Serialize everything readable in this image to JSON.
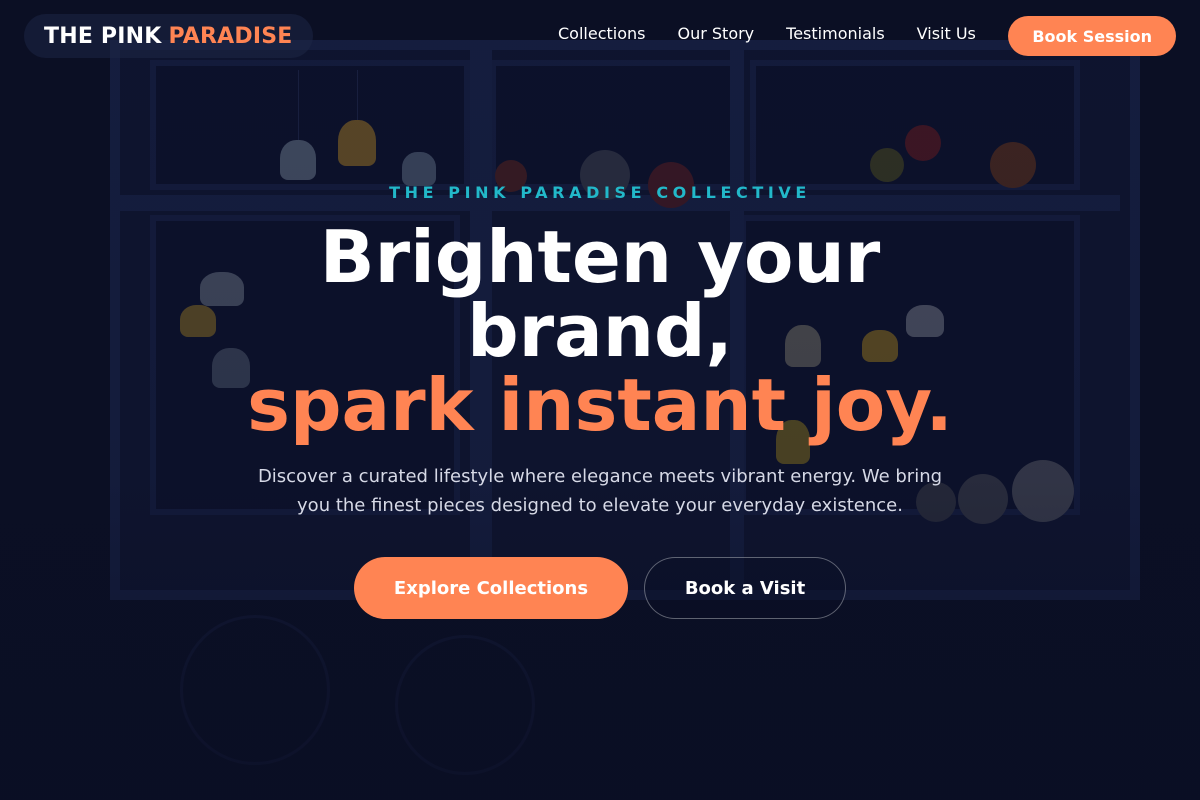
{
  "brand": {
    "name_main": "THE PINK",
    "name_accent": "PARADISE"
  },
  "nav": {
    "links": [
      "Collections",
      "Our Story",
      "Testimonials",
      "Visit Us"
    ],
    "cta": "Book Session"
  },
  "hero": {
    "eyebrow": "THE PINK PARADISE COLLECTIVE",
    "headline_main": "Brighten your brand,",
    "headline_accent": "spark instant joy.",
    "description": "Discover a curated lifestyle where elegance meets vibrant energy. We bring you the finest pieces designed to elevate your everyday existence.",
    "primary_button": "Explore Collections",
    "secondary_button": "Book a Visit"
  },
  "colors": {
    "accent": "#ff8453",
    "eyebrow": "#22b8c9",
    "background": "#0c1024"
  },
  "images": {
    "background": "storefront-window-with-pendant-lamps-and-bicycle"
  }
}
